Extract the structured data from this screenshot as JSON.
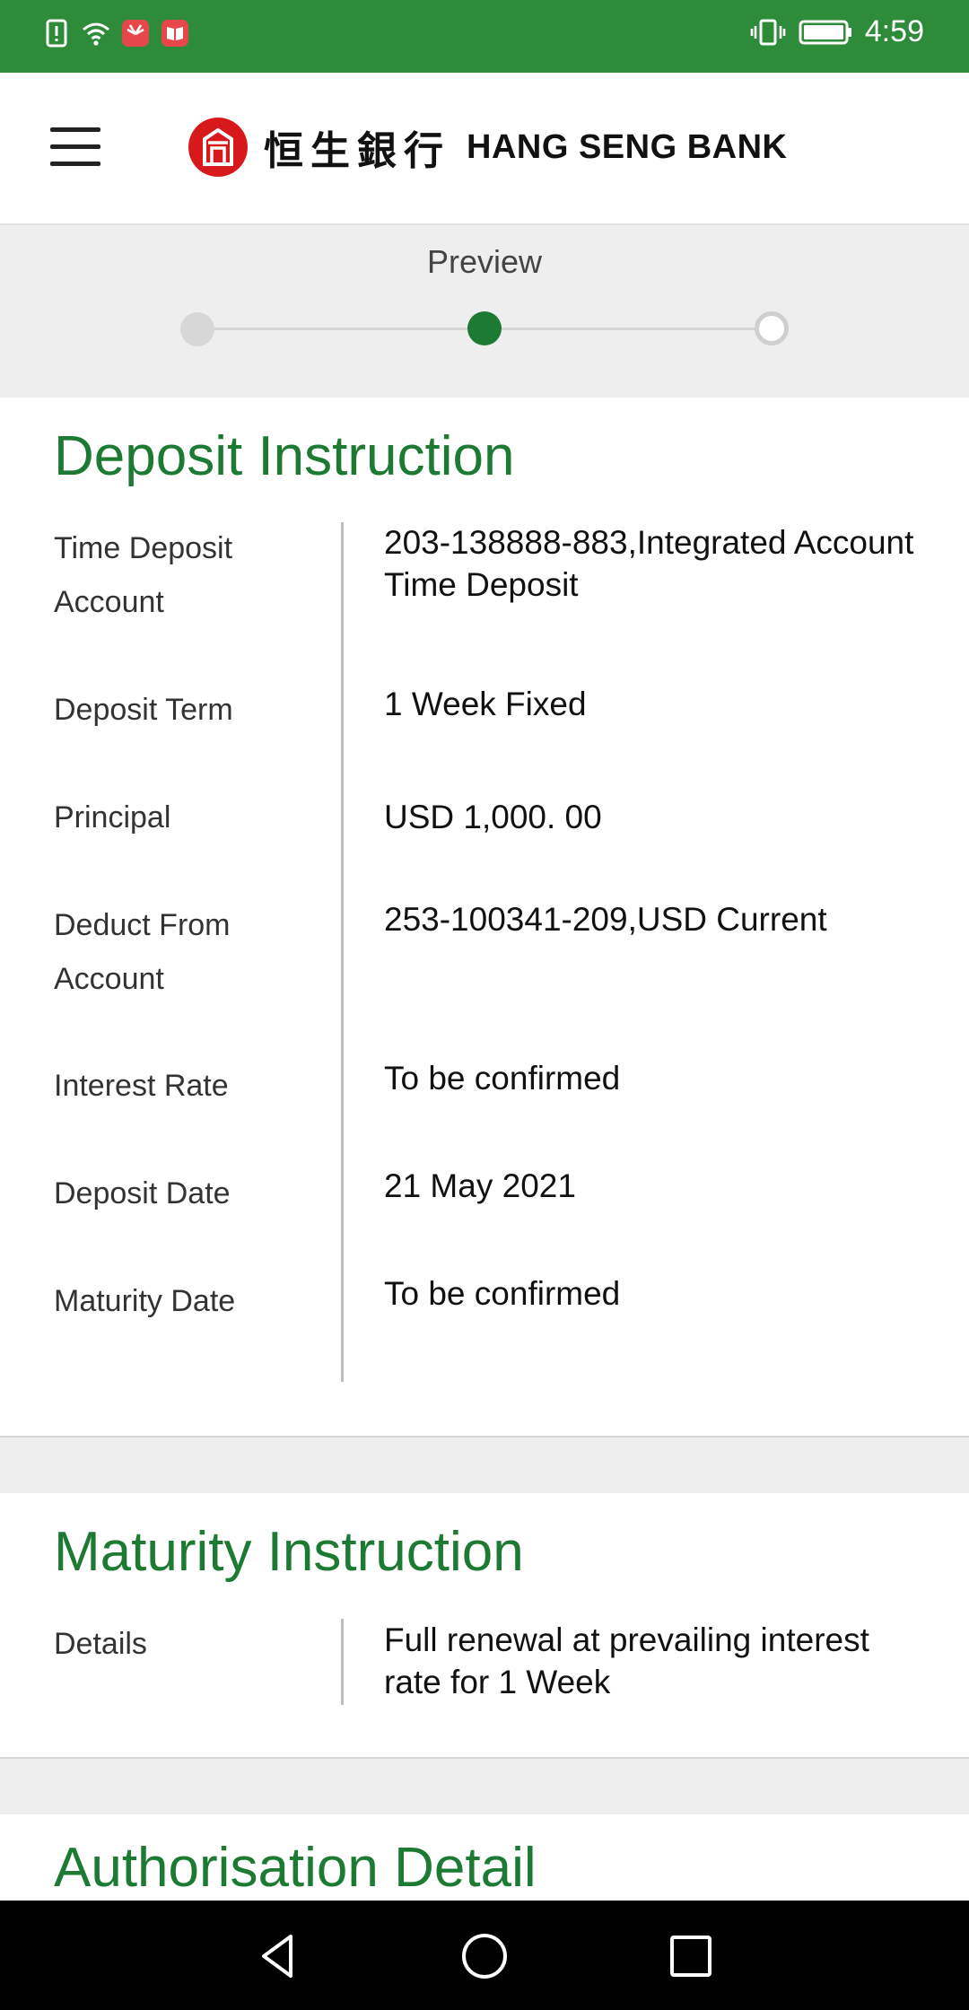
{
  "status_bar": {
    "time": "4:59",
    "icons": [
      "alert-icon",
      "wifi-icon",
      "huawei-app-icon",
      "book-app-icon",
      "vibrate-icon",
      "battery-icon"
    ]
  },
  "header": {
    "logo_cn": "恒生銀行",
    "logo_en": "HANG SENG BANK"
  },
  "progress": {
    "title": "Preview",
    "steps": [
      "completed",
      "current",
      "upcoming"
    ]
  },
  "deposit_instruction": {
    "title": "Deposit Instruction",
    "rows": [
      {
        "label": "Time Deposit Account",
        "value": "203-138888-883,Integrated Account Time Deposit"
      },
      {
        "label": "Deposit Term",
        "value": "1 Week Fixed"
      },
      {
        "label": "Principal",
        "value": "USD 1,000. 00"
      },
      {
        "label": "Deduct From Account",
        "value": "253-100341-209,USD Current"
      },
      {
        "label": "Interest Rate",
        "value": "To be confirmed"
      },
      {
        "label": "Deposit Date",
        "value": "21 May 2021"
      },
      {
        "label": "Maturity Date",
        "value": "To be confirmed"
      }
    ]
  },
  "maturity_instruction": {
    "title": "Maturity Instruction",
    "rows": [
      {
        "label": "Details",
        "value": "Full renewal at prevailing interest rate for 1 Week"
      }
    ]
  },
  "authorisation_detail": {
    "title": "Authorisation Detail"
  },
  "colors": {
    "status_bar": "#2e8b3a",
    "accent_green": "#1d7a33",
    "logo_red": "#d7191c",
    "band_gray": "#eeeeee"
  }
}
